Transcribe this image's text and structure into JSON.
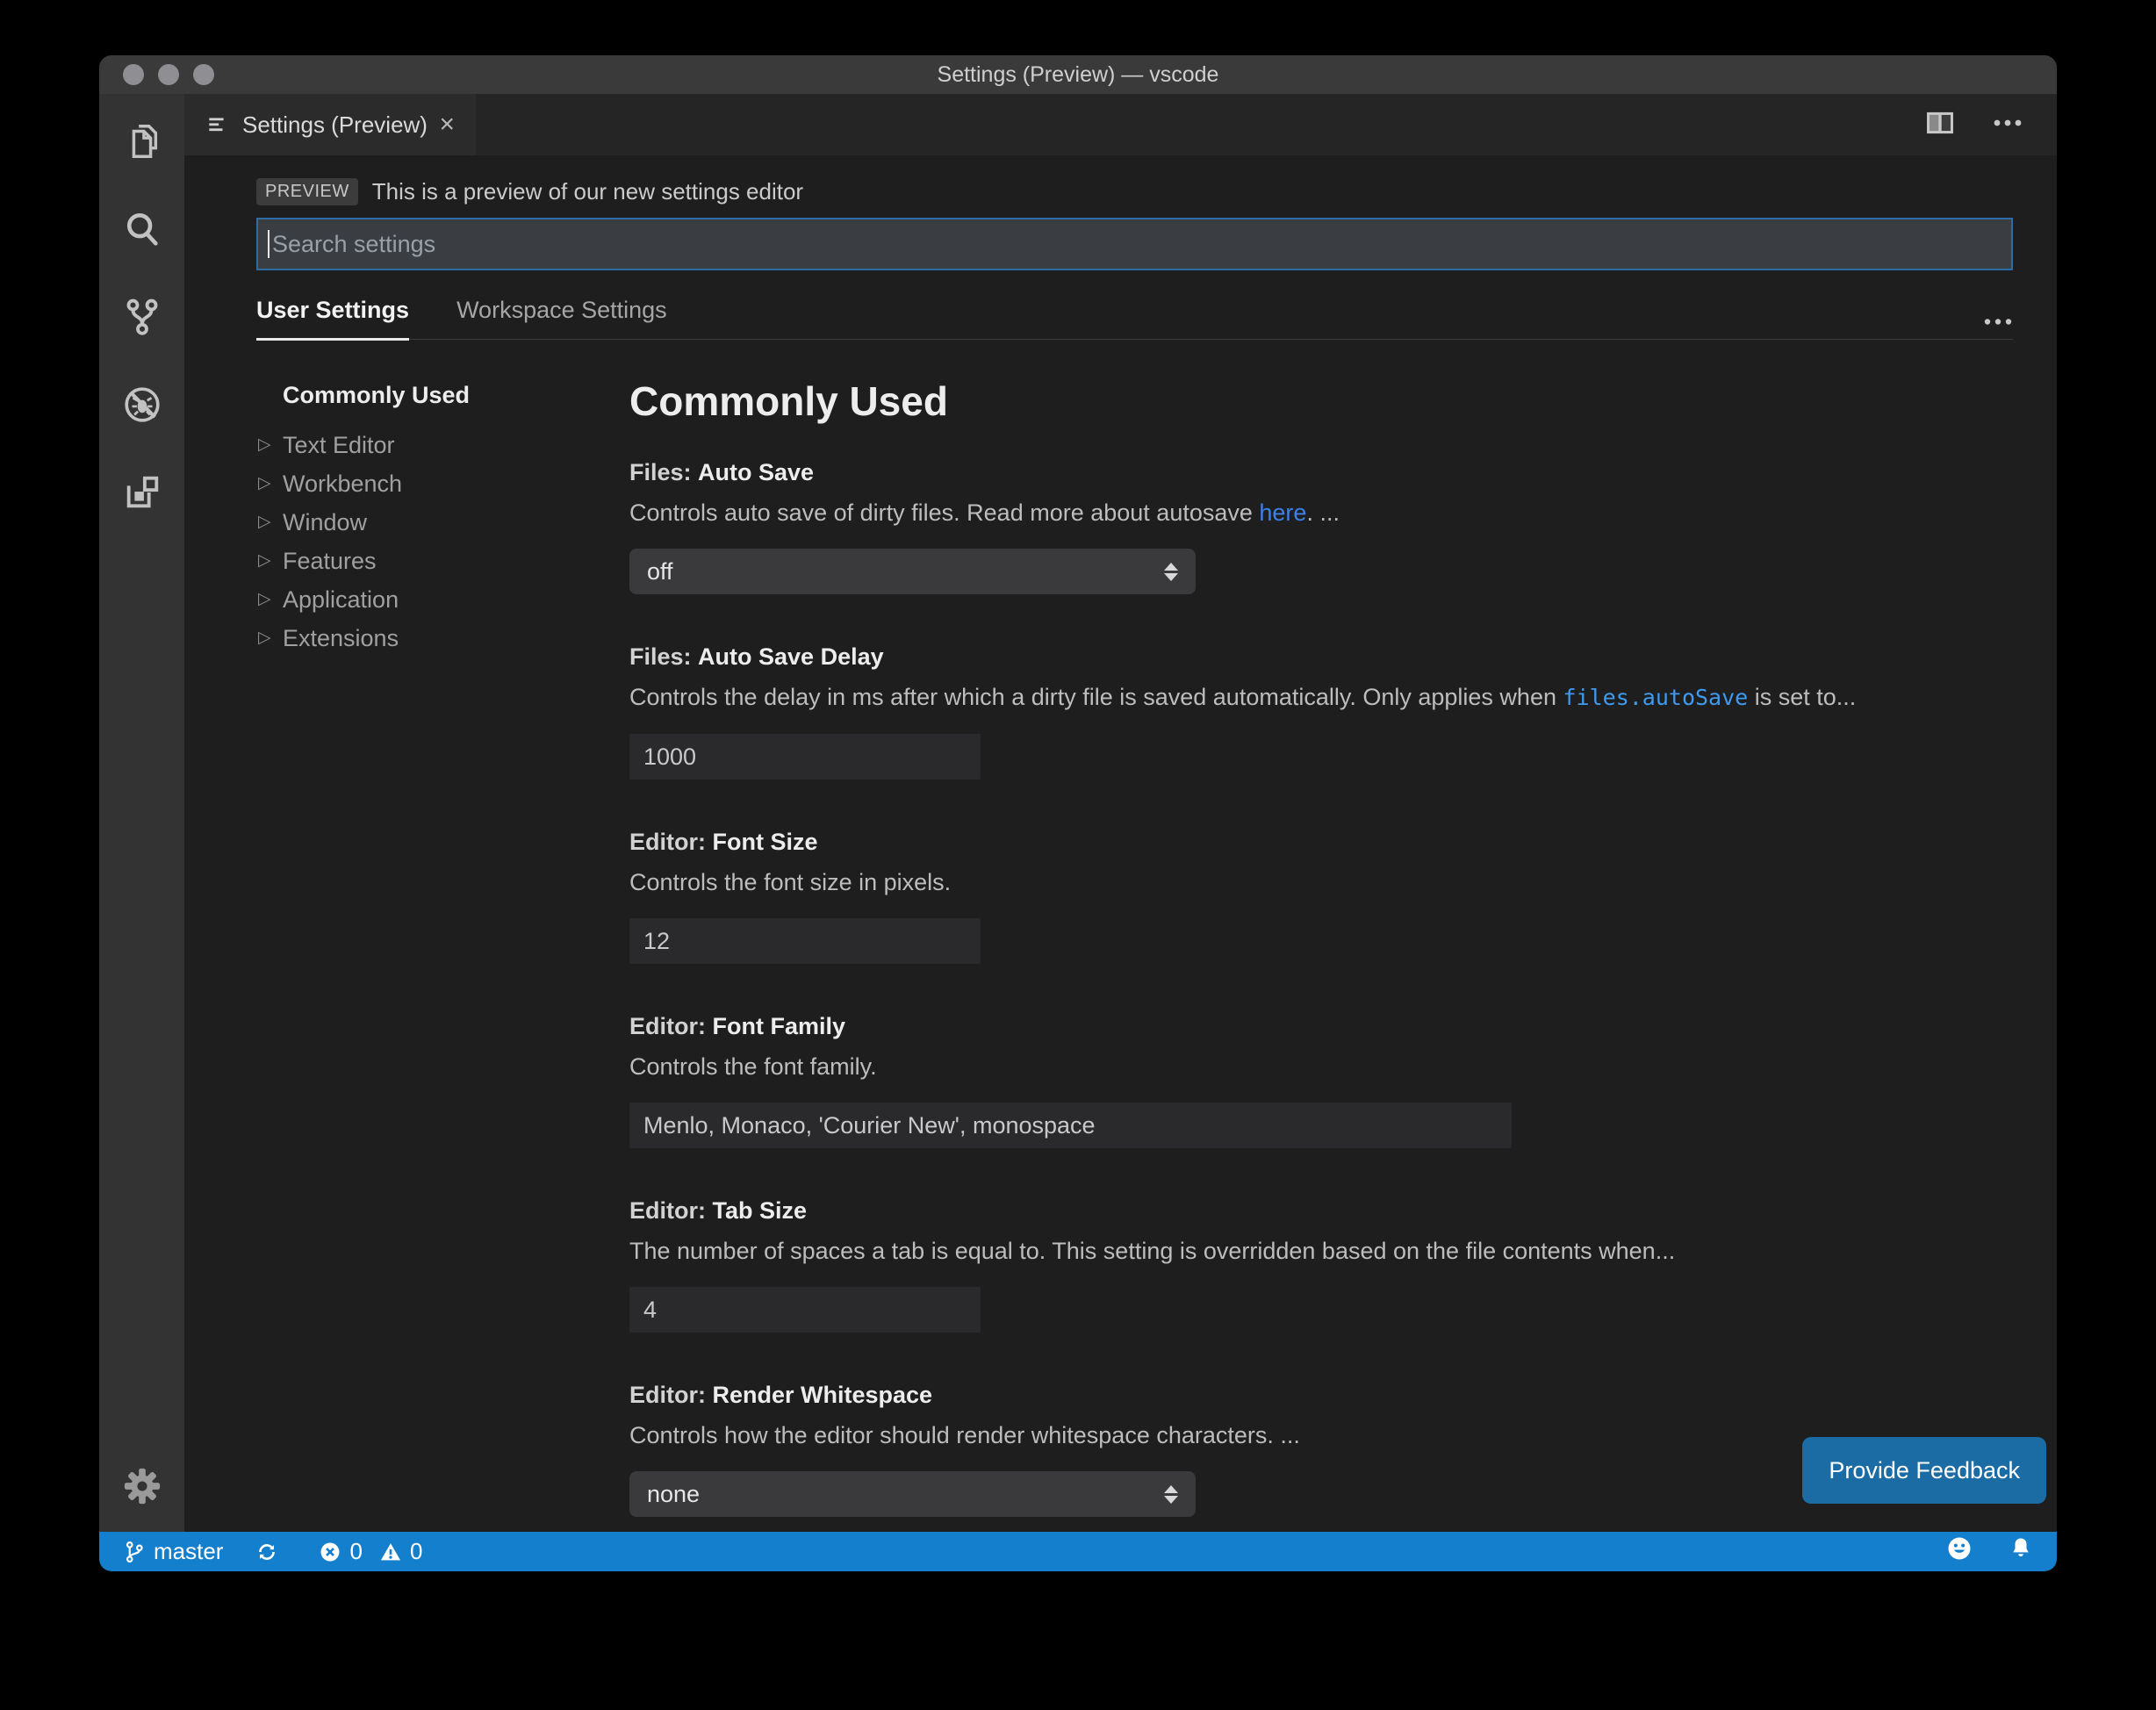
{
  "window": {
    "title": "Settings (Preview) — vscode"
  },
  "tab": {
    "title": "Settings (Preview)",
    "close_glyph": "×"
  },
  "preview": {
    "badge": "PREVIEW",
    "text": "This is a preview of our new settings editor"
  },
  "search": {
    "placeholder": "Search settings",
    "value": ""
  },
  "scope_tabs": [
    {
      "label": "User Settings",
      "active": true
    },
    {
      "label": "Workspace Settings",
      "active": false
    }
  ],
  "toc": {
    "selected": "Commonly Used",
    "items": [
      "Text Editor",
      "Workbench",
      "Window",
      "Features",
      "Application",
      "Extensions"
    ]
  },
  "content": {
    "heading": "Commonly Used",
    "settings": [
      {
        "category": "Files:",
        "name": "Auto Save",
        "desc": [
          {
            "t": "text",
            "v": "Controls auto save of dirty files. Read more about autosave "
          },
          {
            "t": "link",
            "v": "here"
          },
          {
            "t": "text",
            "v": ". ..."
          }
        ],
        "control": {
          "kind": "select",
          "value": "off"
        }
      },
      {
        "category": "Files:",
        "name": "Auto Save Delay",
        "desc": [
          {
            "t": "text",
            "v": "Controls the delay in ms after which a dirty file is saved automatically. Only applies when "
          },
          {
            "t": "code",
            "v": "files.autoSave"
          },
          {
            "t": "text",
            "v": " is set to..."
          }
        ],
        "control": {
          "kind": "input",
          "value": "1000",
          "width": "narrow"
        }
      },
      {
        "category": "Editor:",
        "name": "Font Size",
        "desc": [
          {
            "t": "text",
            "v": "Controls the font size in pixels."
          }
        ],
        "control": {
          "kind": "input",
          "value": "12",
          "width": "narrow"
        }
      },
      {
        "category": "Editor:",
        "name": "Font Family",
        "desc": [
          {
            "t": "text",
            "v": "Controls the font family."
          }
        ],
        "control": {
          "kind": "input",
          "value": "Menlo, Monaco, 'Courier New', monospace",
          "width": "wide"
        }
      },
      {
        "category": "Editor:",
        "name": "Tab Size",
        "desc": [
          {
            "t": "text",
            "v": "The number of spaces a tab is equal to. This setting is overridden based on the file contents when..."
          }
        ],
        "control": {
          "kind": "input",
          "value": "4",
          "width": "narrow"
        }
      },
      {
        "category": "Editor:",
        "name": "Render Whitespace",
        "desc": [
          {
            "t": "text",
            "v": "Controls how the editor should render whitespace characters. ..."
          }
        ],
        "control": {
          "kind": "select",
          "value": "none"
        }
      }
    ],
    "feedback_button": "Provide Feedback"
  },
  "status_bar": {
    "branch": "master",
    "errors": "0",
    "warnings": "0"
  },
  "colors": {
    "status_bar": "#147fcc",
    "button": "#1b6ba4",
    "focus_border": "#2d6ca6",
    "link": "#3c82e8",
    "code_link": "#3f9bf0",
    "editor_bg": "#1e1e1e"
  }
}
